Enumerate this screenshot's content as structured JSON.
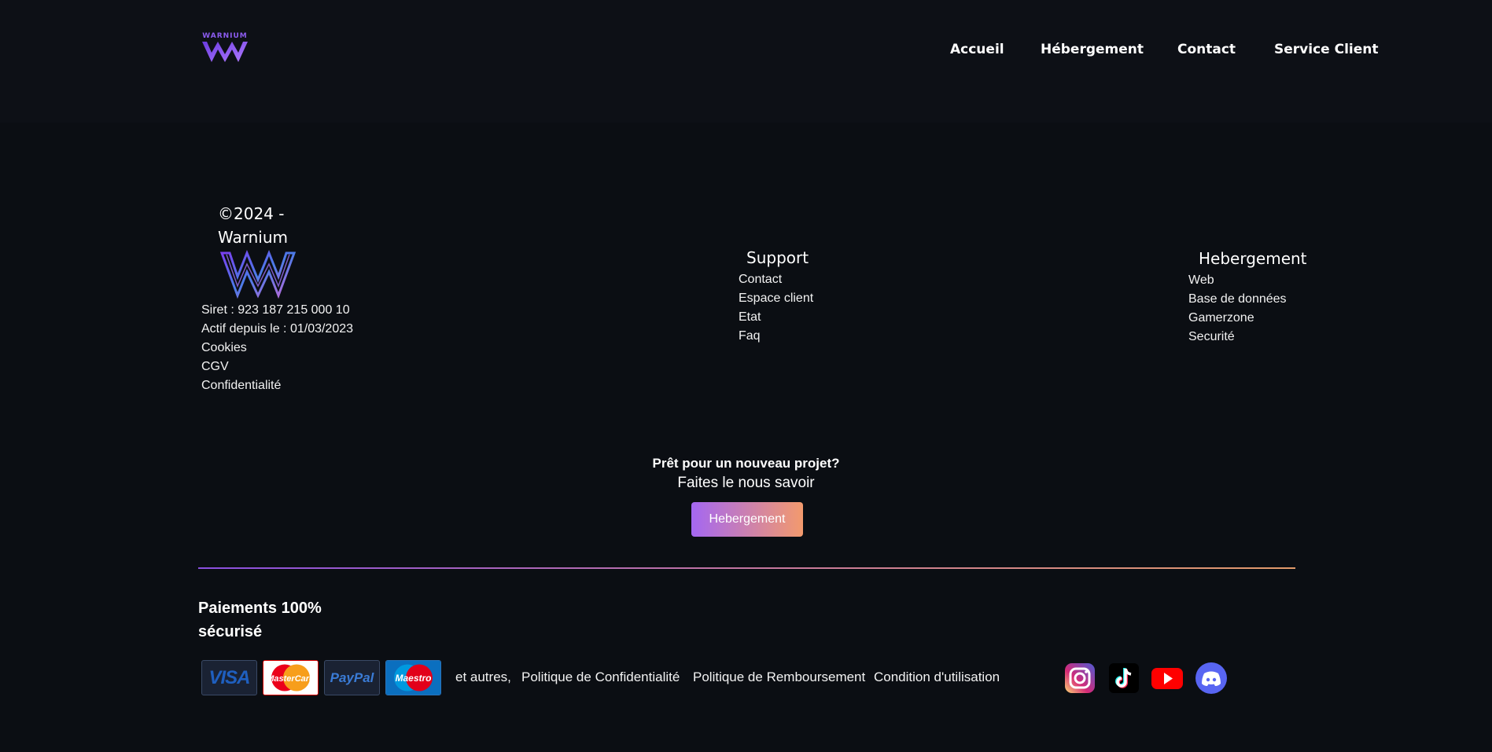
{
  "header": {
    "logo_wordmark": "WARNIUM",
    "nav": [
      "Accueil",
      "Hébergement",
      "Contact",
      "Service Client"
    ]
  },
  "footer": {
    "copyright": "©2024 - Warnium",
    "legal": [
      "Siret : 923 187 215 000 10",
      "Actif depuis le : 01/03/2023",
      "Cookies",
      "CGV",
      "Confidentialité"
    ],
    "support": {
      "title": "Support",
      "items": [
        "Contact",
        "Espace client",
        "Etat",
        "Faq"
      ]
    },
    "hebergement": {
      "title": "Hebergement",
      "items": [
        "Web",
        "Base de données",
        "Gamerzone",
        "Securité"
      ]
    }
  },
  "cta": {
    "question": "Prêt pour un nouveau projet?",
    "subtitle": "Faites le nous savoir",
    "button": "Hebergement"
  },
  "payments": {
    "title": "Paiements 100% sécurisé",
    "cards": [
      "VISA",
      "MasterCard",
      "PayPal",
      "Maestro"
    ],
    "others": "et autres,",
    "links": [
      "Politique de Confidentialité",
      "Politique de Remboursement",
      "Condition d'utilisation"
    ]
  },
  "social": [
    "instagram-icon",
    "tiktok-icon",
    "youtube-icon",
    "discord-icon"
  ],
  "colors": {
    "background": "#0b0e13",
    "header": "#0d1016",
    "accent_purple": "#a467f2",
    "accent_orange": "#f39a6d"
  }
}
